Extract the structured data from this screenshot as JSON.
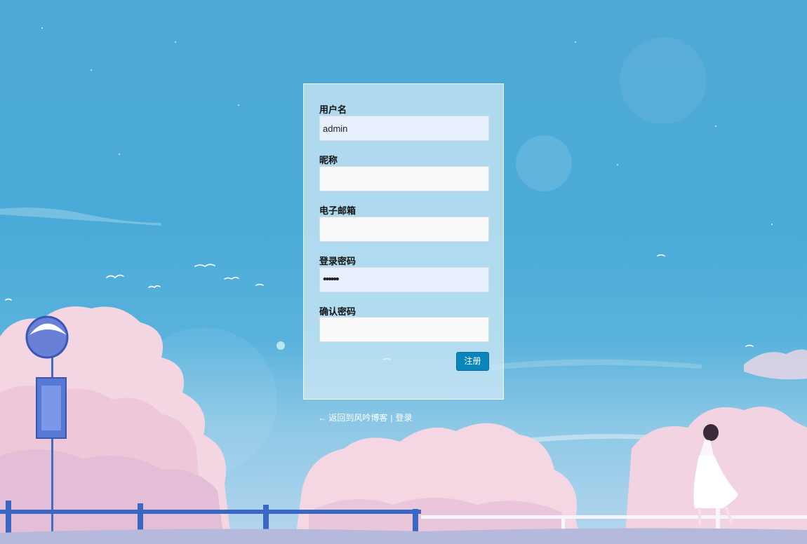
{
  "form": {
    "username_label": "用户名",
    "username_value": "admin",
    "nickname_label": "昵称",
    "nickname_value": "",
    "email_label": "电子邮箱",
    "email_value": "",
    "password_label": "登录密码",
    "password_value": "••••••",
    "confirm_label": "确认密码",
    "confirm_value": "",
    "submit_label": "注册"
  },
  "footer": {
    "back_link": "← 返回到风吟博客",
    "separator": "|",
    "login_link": "登录"
  },
  "colors": {
    "accent": "#0a85ba",
    "sky": "#4aaad8"
  }
}
